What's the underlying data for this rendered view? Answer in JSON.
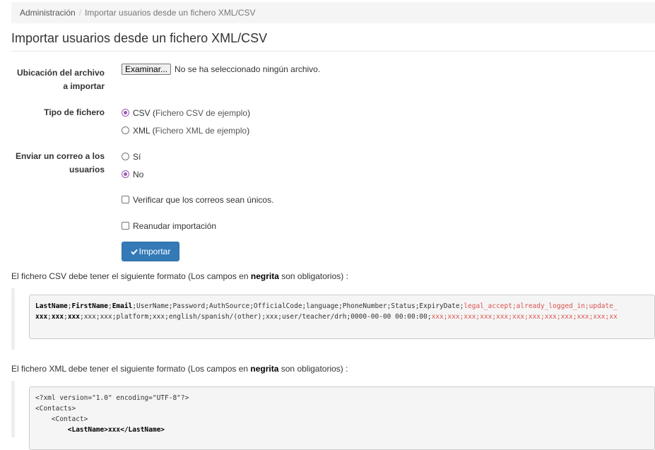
{
  "breadcrumb": {
    "home": "Administración",
    "separator": "/",
    "current": "Importar usuarios desde un fichero XML/CSV"
  },
  "page_title": "Importar usuarios desde un fichero XML/CSV",
  "form": {
    "file": {
      "label": "Ubicación del archivo a importar",
      "button": "Examinar...",
      "status": "No se ha seleccionado ningún archivo."
    },
    "file_type": {
      "label": "Tipo de fichero",
      "options": [
        {
          "label": "CSV",
          "open": " (",
          "link": "Fichero CSV de ejemplo",
          "close": ")",
          "selected": true
        },
        {
          "label": "XML",
          "open": " (",
          "link": "Fichero XML de ejemplo",
          "close": ")",
          "selected": false
        }
      ]
    },
    "send_mail": {
      "label": "Enviar un correo a los usuarios",
      "options": [
        {
          "label": "Sí",
          "selected": false
        },
        {
          "label": "No",
          "selected": true
        }
      ]
    },
    "unique_emails": {
      "label": "Verificar que los correos sean únicos.",
      "checked": false
    },
    "resume_import": {
      "label": "Reanudar importación",
      "checked": false
    },
    "submit": {
      "label": "Importar",
      "icon": "check-icon"
    }
  },
  "csv_help": {
    "intro_before": "El fichero CSV debe tener el siguiente formato (Los campos en ",
    "intro_bold": "negrita",
    "intro_after": " son obligatorios) :",
    "line1": {
      "required": [
        "LastName",
        "FirstName",
        "Email"
      ],
      "optional": ";UserName;Password;AuthSource;OfficialCode;language;PhoneNumber;Status;ExpiryDate;",
      "extra": "legal_accept;already_logged_in;update_"
    },
    "line2": {
      "required": [
        "xxx",
        "xxx",
        "xxx"
      ],
      "optional": ";xxx;xxx;platform;xxx;english/spanish/(other);xxx;user/teacher/drh;0000-00-00 00:00:00;",
      "extra": "xxx;xxx;xxx;xxx;xxx;xxx;xxx;xxx;xxx;xxx;xxx;xx"
    }
  },
  "xml_help": {
    "intro_before": "El fichero XML debe tener el siguiente formato (Los campos en ",
    "intro_bold": "negrita",
    "intro_after": " son obligatorios) :",
    "lines": [
      "<?xml version=\"1.0\" encoding=\"UTF-8\"?>",
      "<Contacts>",
      "    <Contact>"
    ],
    "bold_line": "        <LastName>xxx</LastName>"
  },
  "colors": {
    "primary": "#337ab7",
    "radio_accent": "#9b59b6",
    "optional_red": "#d9534f"
  }
}
